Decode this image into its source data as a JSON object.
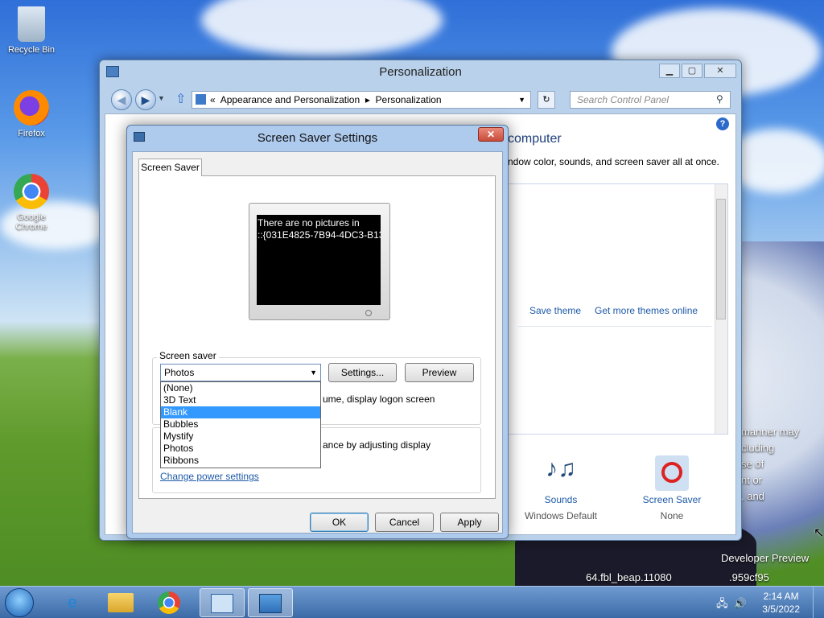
{
  "desktop": {
    "icons": [
      {
        "label": "Recycle Bin",
        "icon": "recycle-bin-icon"
      },
      {
        "label": "Firefox",
        "icon": "firefox-icon"
      },
      {
        "label": "Google Chrome",
        "icon": "chrome-icon"
      }
    ],
    "watermark": {
      "line1": "Developer Preview",
      "line2": "64.fbl_beap.11080",
      "line3": ".959cf95",
      "side_lines": [
        "manner may",
        "cluding",
        "se of",
        "nt or",
        ", and"
      ]
    }
  },
  "personalization": {
    "title": "Personalization",
    "controls": {
      "minimize": "▁",
      "maximize": "▢",
      "close": "✕"
    },
    "breadcrumb": {
      "prefix": "«",
      "part1": "Appearance and Personalization",
      "sep": "▸",
      "part2": "Personalization"
    },
    "search_placeholder": "Search Control Panel",
    "heading_fragment": "computer",
    "description_fragment": "ndow color, sounds, and screen saver all at once.",
    "save_theme": "Save theme",
    "get_more_themes": "Get more themes online",
    "bottom_items": [
      {
        "label": "Sounds",
        "sub": "Windows Default",
        "icon": "music-notes-icon"
      },
      {
        "label": "Screen Saver",
        "sub": "None",
        "icon": "no-screensaver-icon"
      }
    ]
  },
  "dialog": {
    "title": "Screen Saver Settings",
    "tab": "Screen Saver",
    "preview_line1": "There are no pictures in",
    "preview_line2": "::{031E4825-7B94-4DC3-B131",
    "group_label": "Screen saver",
    "selected": "Photos",
    "settings_button": "Settings...",
    "preview_button": "Preview",
    "options": [
      "(None)",
      "3D Text",
      "Blank",
      "Bubbles",
      "Mystify",
      "Photos",
      "Ribbons"
    ],
    "highlighted_option": "Blank",
    "logon_text_fragment": "ume, display logon screen",
    "power_text_fragment": "ance by adjusting display",
    "power_link": "Change power settings",
    "ok": "OK",
    "cancel": "Cancel",
    "apply": "Apply"
  },
  "taskbar": {
    "time": "2:14 AM",
    "date": "3/5/2022",
    "items": [
      "ie-icon",
      "explorer-icon",
      "chrome-icon",
      "control-panel-icon",
      "personalization-icon"
    ]
  }
}
